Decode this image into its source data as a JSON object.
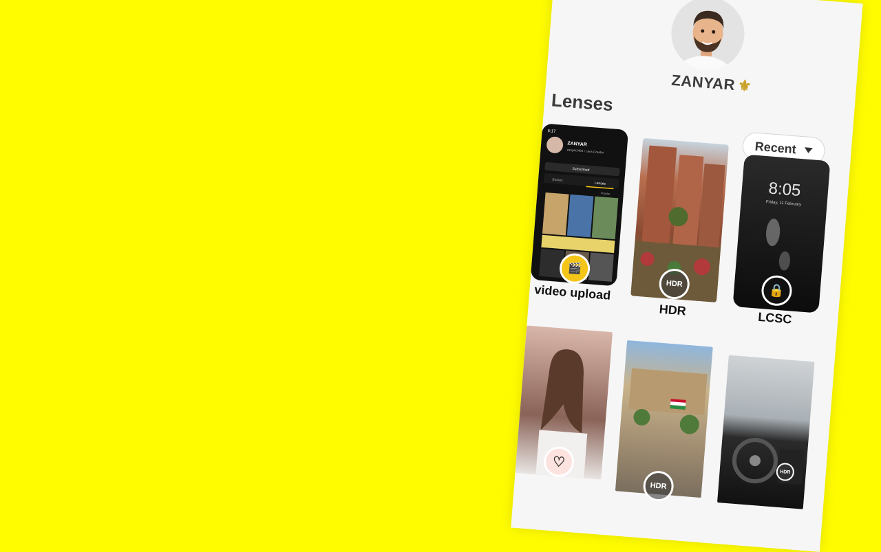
{
  "profile": {
    "name": "ZANYAR",
    "name_icon": "fleur-de-lis-icon"
  },
  "section": {
    "title": "Lenses",
    "sort_label": "Recent"
  },
  "lenses": [
    {
      "label": "video upload",
      "icon": "clapper-icon"
    },
    {
      "label": "HDR",
      "badge": "HDR"
    },
    {
      "label": "LCSC",
      "icon": "lock-icon",
      "clock": "8:05",
      "date": "Friday, 11 February"
    },
    {
      "label": "",
      "icon": "heart-icon"
    },
    {
      "label": "",
      "badge": "HDR"
    },
    {
      "label": "",
      "badge": "HDR"
    }
  ],
  "mini_profile": {
    "time": "6:17",
    "name": "ZANYAR",
    "subtitle": "zanyar1463 • Lens Creator",
    "subscribe": "Subscribed",
    "tab_stories": "Stories",
    "tab_lenses": "Lenses",
    "filter": "Popular"
  },
  "colors": {
    "background": "#FFFC00",
    "card": "#f6f6f6",
    "accent": "#f5c518"
  }
}
